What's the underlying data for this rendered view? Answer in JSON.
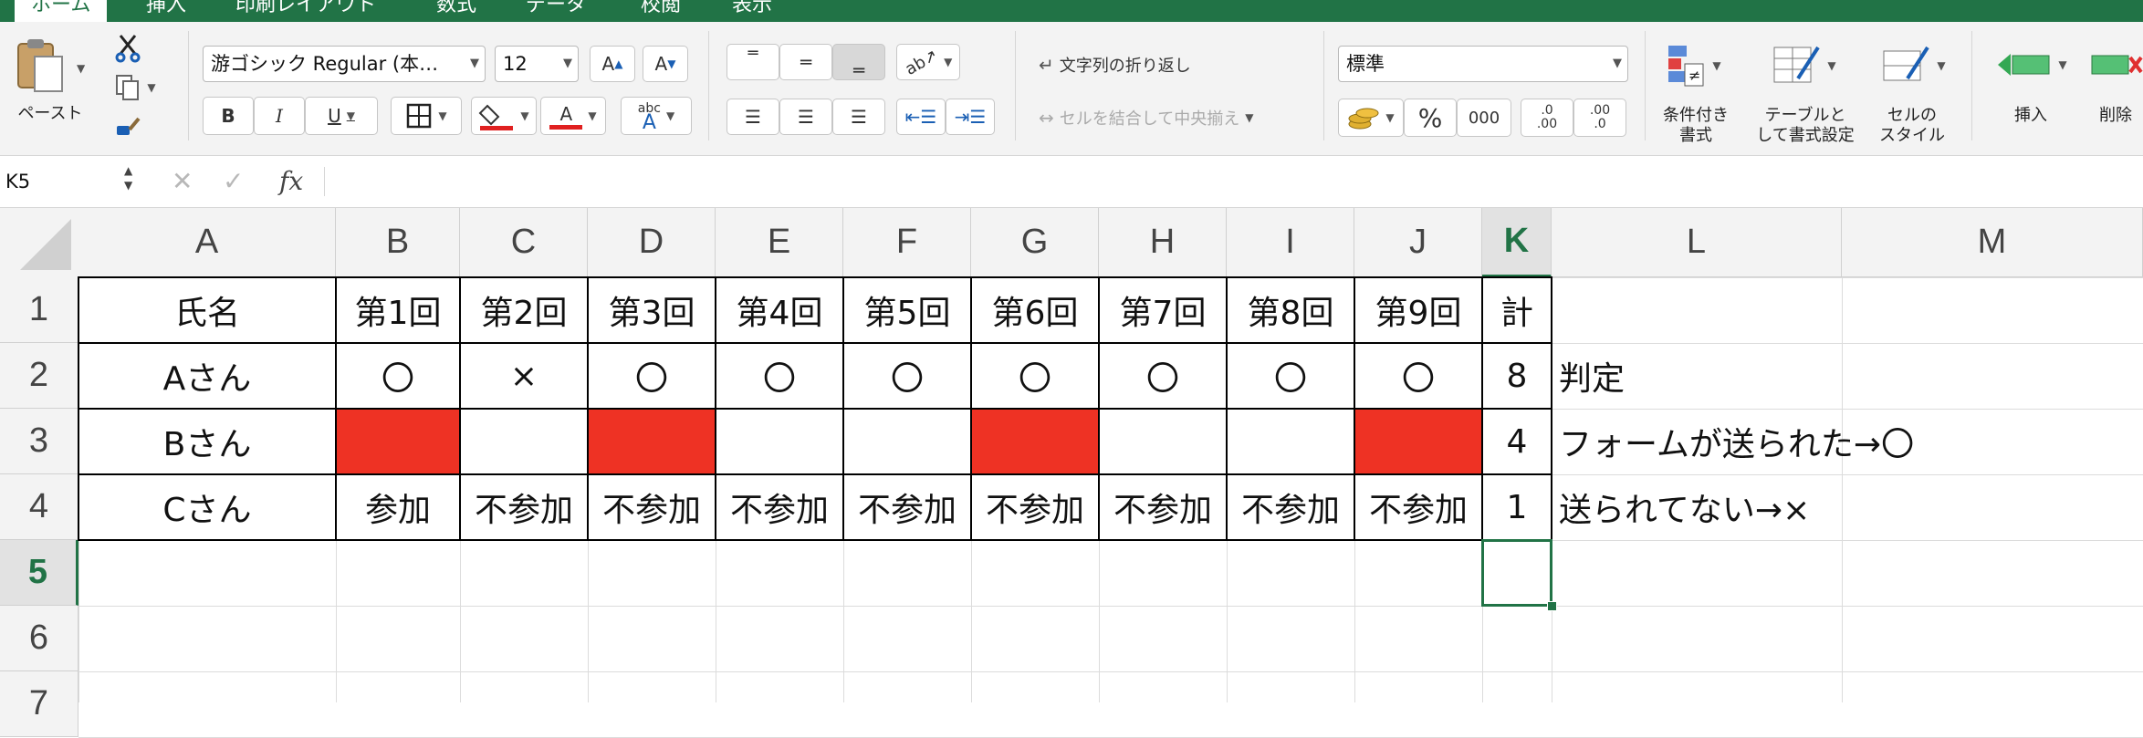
{
  "tabs": [
    "ホーム",
    "挿入",
    "印刷レイアウト",
    "数式",
    "データ",
    "校閲",
    "表示"
  ],
  "ribbon": {
    "paste_label": "ペースト",
    "font_name": "游ゴシック Regular (本…",
    "font_size": "12",
    "wrap_text": "文字列の折り返し",
    "merge_center": "セルを結合して中央揃え",
    "number_format": "標準",
    "percent": "%",
    "thousands": "000",
    "dec_increase": ".0\n.00",
    "dec_decrease": ".00\n.0",
    "cond_format": "条件付き\n書式",
    "table_format": "テーブルと\nして書式設定",
    "cell_styles": "セルの\nスタイル",
    "insert": "挿入",
    "delete": "削除",
    "bold": "B",
    "italic": "I",
    "underline": "U",
    "font_grow": "A",
    "font_shrink": "A",
    "font_color_glyph": "A",
    "abc": "abc"
  },
  "formula_bar": {
    "name_box": "K5",
    "fx": "fx",
    "cancel": "✕",
    "enter": "✓",
    "content": ""
  },
  "colors": {
    "accent": "#217346",
    "red_fill": "#ee3224"
  },
  "columns": [
    "A",
    "B",
    "C",
    "D",
    "E",
    "F",
    "G",
    "H",
    "I",
    "J",
    "K",
    "L",
    "M"
  ],
  "rows": [
    "1",
    "2",
    "3",
    "4",
    "5",
    "6",
    "7"
  ],
  "selected": {
    "column": "K",
    "row": "5",
    "cell": "K5"
  },
  "cells": {
    "A1": "氏名",
    "B1": "第1回",
    "C1": "第2回",
    "D1": "第3回",
    "E1": "第4回",
    "F1": "第5回",
    "G1": "第6回",
    "H1": "第7回",
    "I1": "第8回",
    "J1": "第9回",
    "K1": "計",
    "A2": "Aさん",
    "B2": "〇",
    "C2": "×",
    "D2": "〇",
    "E2": "〇",
    "F2": "〇",
    "G2": "〇",
    "H2": "〇",
    "I2": "〇",
    "J2": "〇",
    "K2": "8",
    "L2": "判定",
    "A3": "Bさん",
    "K3": "4",
    "L3": "フォームが送られた→〇",
    "A4": "Cさん",
    "B4": "参加",
    "C4": "不参加",
    "D4": "不参加",
    "E4": "不参加",
    "F4": "不参加",
    "G4": "不参加",
    "H4": "不参加",
    "I4": "不参加",
    "J4": "不参加",
    "K4": "1",
    "L4": "送られてない→×"
  },
  "red_cells": [
    "B3",
    "D3",
    "G3",
    "J3"
  ]
}
